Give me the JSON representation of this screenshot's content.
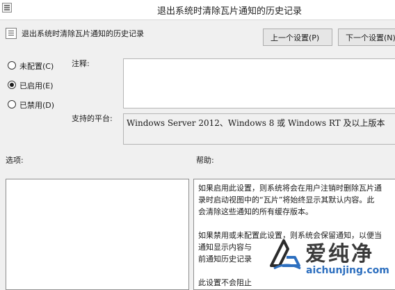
{
  "window": {
    "title": "退出系统时清除瓦片通知的历史记录"
  },
  "policy": {
    "name": "退出系统时清除瓦片通知的历史记录"
  },
  "buttons": {
    "prev": "上一个设置(P)",
    "next": "下一个设置(N)"
  },
  "state": {
    "options": [
      {
        "label": "未配置(C)",
        "checked": false
      },
      {
        "label": "已启用(E)",
        "checked": true
      },
      {
        "label": "已禁用(D)",
        "checked": false
      }
    ]
  },
  "comment": {
    "label": "注释:",
    "value": ""
  },
  "platform": {
    "label": "支持的平台:",
    "value": "Windows Server 2012、Windows 8 或 Windows RT 及以上版本"
  },
  "options_section": {
    "label": "选项:"
  },
  "help": {
    "label": "帮助:",
    "paragraphs": [
      "如果启用此设置，则系统将会在用户注销时删除瓦片通\n录时启动视图中的“瓦片”将始终显示其默认内容。此\n会清除这些通知的所有缓存版本。",
      "如果禁用或未配置此设置，则系统会保留通知，以便当\n通知显示内容与\n前通知历史记录",
      "此设置不会阻止"
    ]
  },
  "watermark": {
    "title": "爱纯净",
    "url": "aichunjing.com",
    "accent_color": "#2d6fbf"
  },
  "icons": {
    "app": "group-policy-settings-icon",
    "policy": "policy-setting-icon",
    "watermark_logo": "aichunjing-logo-icon"
  }
}
